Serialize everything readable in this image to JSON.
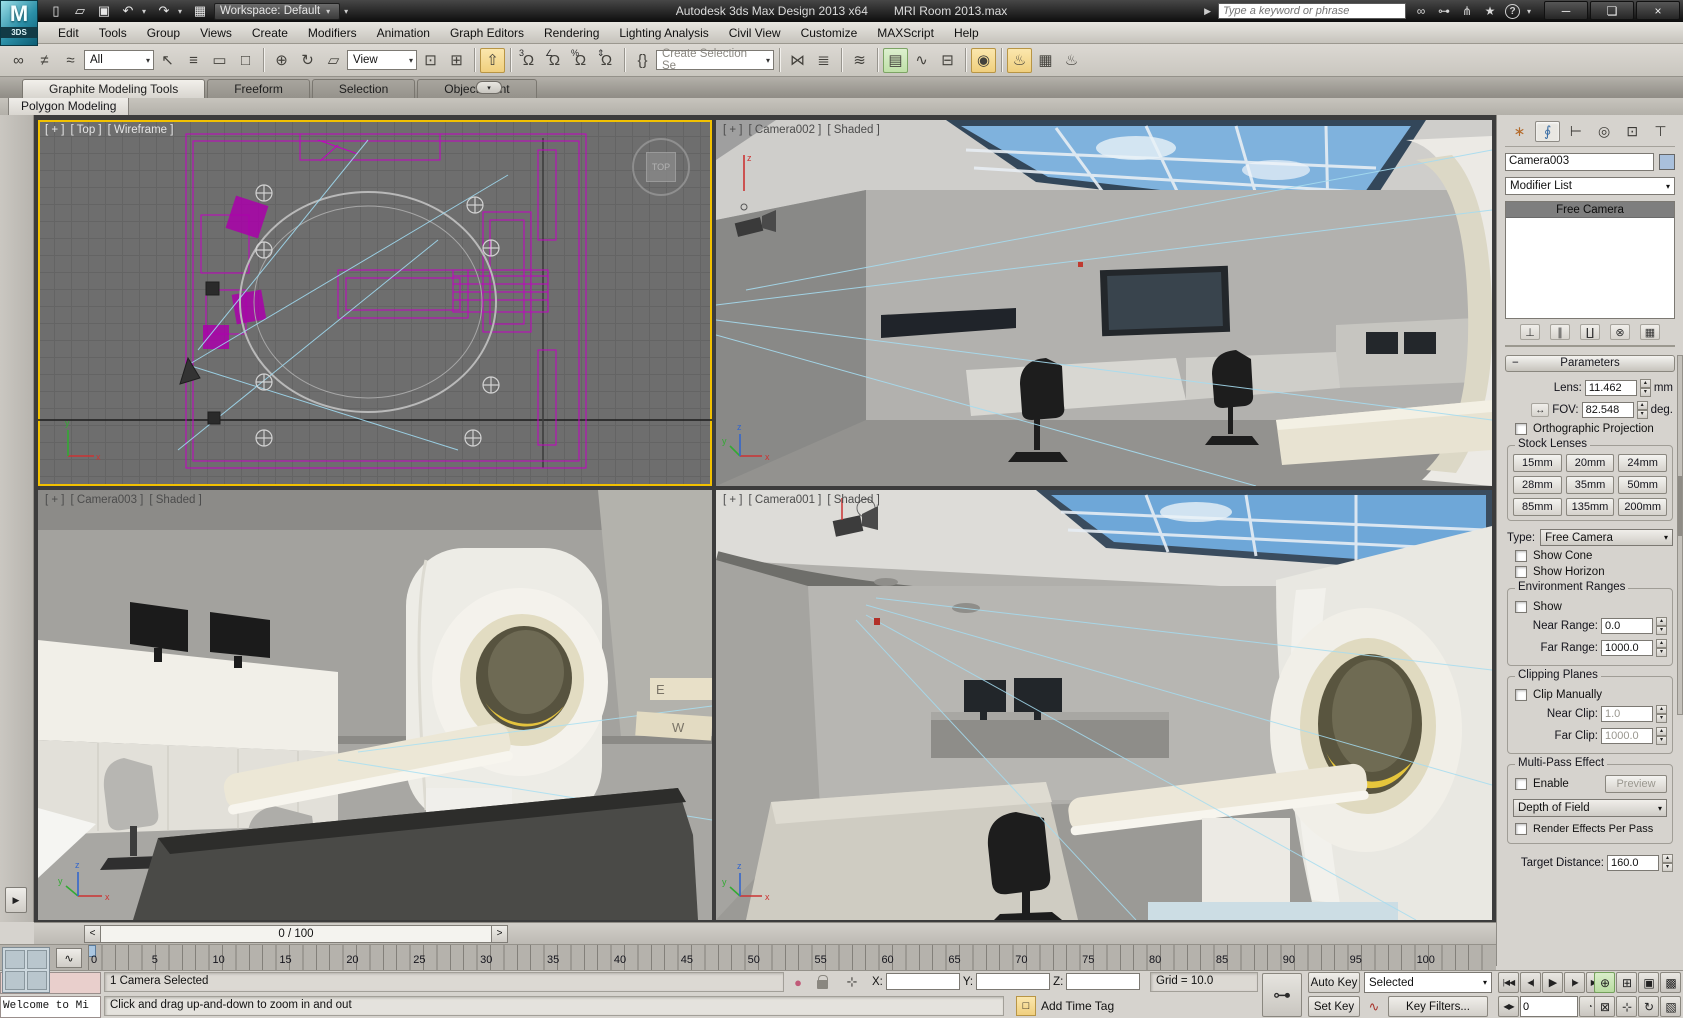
{
  "titlebar": {
    "logo_badge": "3DS",
    "workspace": "Workspace: Default",
    "app_title": "Autodesk 3ds Max Design 2013 x64",
    "doc_title": "MRI Room 2013.max",
    "search_placeholder": "Type a keyword or phrase"
  },
  "menus": [
    "Edit",
    "Tools",
    "Group",
    "Views",
    "Create",
    "Modifiers",
    "Animation",
    "Graph Editors",
    "Rendering",
    "Lighting Analysis",
    "Civil View",
    "Customize",
    "MAXScript",
    "Help"
  ],
  "toolbar": {
    "selection_filter": "All",
    "ref_coord": "View",
    "named_selection": "Create Selection Se",
    "snap_value": "3"
  },
  "ribbon": {
    "tabs": [
      "Graphite Modeling Tools",
      "Freeform",
      "Selection",
      "Object Paint"
    ],
    "active_tab": "Graphite Modeling Tools",
    "panel_tab": "Polygon Modeling"
  },
  "viewports": {
    "top_left": {
      "pos": "[ + ]",
      "view": "[ Top ]",
      "shading": "[ Wireframe ]",
      "viewcube": "TOP"
    },
    "top_right": {
      "pos": "[ + ]",
      "view": "[ Camera002 ]",
      "shading": "[ Shaded ]"
    },
    "bottom_left": {
      "pos": "[ + ]",
      "view": "[ Camera003 ]",
      "shading": "[ Shaded ]"
    },
    "bottom_right": {
      "pos": "[ + ]",
      "view": "[ Camera001 ]",
      "shading": "[ Shaded ]"
    },
    "sign_letters": {
      "e": "E",
      "w": "W"
    }
  },
  "command_panel": {
    "object_name": "Camera003",
    "modifier_list_label": "Modifier List",
    "stack": [
      "Free Camera"
    ],
    "rollout_title": "Parameters",
    "lens_label": "Lens:",
    "lens_value": "11.462",
    "lens_unit": "mm",
    "fov_label": "FOV:",
    "fov_value": "82.548",
    "fov_unit": "deg.",
    "ortho_label": "Orthographic Projection",
    "stock_title": "Stock Lenses",
    "stock_lenses": [
      "15mm",
      "20mm",
      "24mm",
      "28mm",
      "35mm",
      "50mm",
      "85mm",
      "135mm",
      "200mm"
    ],
    "type_label": "Type:",
    "type_value": "Free Camera",
    "show_cone": "Show Cone",
    "show_horizon": "Show Horizon",
    "env_title": "Environment Ranges",
    "env_show": "Show",
    "near_range_label": "Near Range:",
    "near_range_value": "0.0",
    "far_range_label": "Far Range:",
    "far_range_value": "1000.0",
    "clip_title": "Clipping Planes",
    "clip_manually": "Clip Manually",
    "near_clip_label": "Near Clip:",
    "near_clip_value": "1.0",
    "far_clip_label": "Far Clip:",
    "far_clip_value": "1000.0",
    "multipass_title": "Multi-Pass Effect",
    "enable_label": "Enable",
    "preview_label": "Preview",
    "multipass_type": "Depth of Field",
    "per_pass_label": "Render Effects Per Pass",
    "target_distance_label": "Target Distance:",
    "target_distance_value": "160.0"
  },
  "timeline": {
    "slider_value": "0 / 100",
    "ticks": [
      "0",
      "5",
      "10",
      "15",
      "20",
      "25",
      "30",
      "35",
      "40",
      "45",
      "50",
      "55",
      "60",
      "65",
      "70",
      "75",
      "80",
      "85",
      "90",
      "95",
      "100"
    ]
  },
  "statusbar": {
    "listener_text": "Welcome to Mi",
    "selection_status": "1 Camera Selected",
    "prompt": "Click and drag up-and-down to zoom in and out",
    "x_label": "X:",
    "y_label": "Y:",
    "z_label": "Z:",
    "grid_label": "Grid = 10.0",
    "add_time_tag": "Add Time Tag",
    "auto_key": "Auto Key",
    "set_key": "Set Key",
    "selected_dropdown": "Selected",
    "key_filters": "Key Filters...",
    "frame_field": "0"
  },
  "colors": {
    "active_viewport_border": "#f2c100",
    "toolbar_highlight_yellow": "#f0cf7e",
    "toolbar_highlight_green": "#bfe0a8",
    "wireframe_magenta": "#c400c4",
    "camera_cone_cyan": "#9fd8ee",
    "sky_blue": "#6fa3d4",
    "mri_accent_yellow": "#e6c63c",
    "object_color_swatch": "#a9c0dc"
  },
  "icons": {
    "autodesk-m": "M",
    "qa-new": "▯",
    "qa-open": "▱",
    "qa-save": "▣",
    "qa-undo": "↶",
    "qa-redo": "↷",
    "qa-project": "▦",
    "dropdown-arrow": "▾",
    "infocenter-next": "▶",
    "search-binoculars": "∞",
    "keytip": "⊶",
    "comm-center": "⋔",
    "favorites-star": "★",
    "help-q": "?",
    "win-min": "─",
    "win-restore": "❏",
    "win-close": "×",
    "link": "∞",
    "unlink": "≠",
    "bind": "≈",
    "cursor": "↖",
    "by-name": "≡",
    "region": "▭",
    "crossing": "□",
    "move": "⊕",
    "rotate": "↻",
    "scale": "▱",
    "pivot": "⊡",
    "manip": "⊞",
    "kbd": "⇧",
    "magnet": "Ω",
    "angle": "∠",
    "percent": "%",
    "updown": "⇕",
    "sets": "{}",
    "mirror": "⋈",
    "align": "≣",
    "layers": "≋",
    "ribbon": "▤",
    "curve": "∿",
    "schem": "⊟",
    "material": "◉",
    "teapot": "♨",
    "frame-win": "▦",
    "cp-create": "∗",
    "cp-modify": "∮",
    "cp-hier": "⊢",
    "cp-motion": "◎",
    "cp-display": "⊡",
    "cp-utils": "⊤",
    "pin": "⊥",
    "endresult": "∥",
    "unique": "∐",
    "remove": "⊗",
    "config": "▦",
    "fov-dir": "↔",
    "minus": "−",
    "su": "▴",
    "sd": "▾",
    "lt": "<",
    "gt": ">",
    "flyout": "▶",
    "lamp": "●",
    "gizmo": "⊹",
    "mono-key": "⊶",
    "red-curve": "∿",
    "cube": "□",
    "pb-start": "|◀◀",
    "pb-prev": "◀|",
    "pb-play": "▶",
    "pb-next": "|▶",
    "pb-end": "▶▶|",
    "pb-keymode": "◀▶",
    "nav-zoom": "⊕",
    "nav-zoomall": "⊞",
    "nav-ext": "▣",
    "nav-extall": "▩",
    "nav-time": "◔",
    "nav-region": "⊠",
    "nav-pan": "⊹",
    "nav-orbit": "↻",
    "nav-max": "▧"
  }
}
